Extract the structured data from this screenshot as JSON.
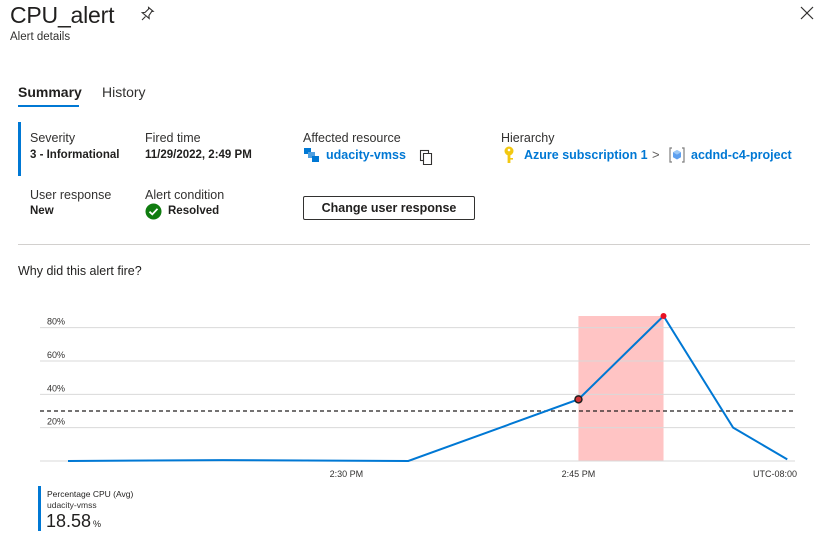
{
  "header": {
    "title": "CPU_alert",
    "subtitle": "Alert details"
  },
  "tabs": [
    {
      "label": "Summary",
      "active": true
    },
    {
      "label": "History",
      "active": false
    }
  ],
  "summary": {
    "severity_label": "Severity",
    "severity_value": "3 - Informational",
    "fired_label": "Fired time",
    "fired_value": "11/29/2022, 2:49 PM",
    "affected_label": "Affected resource",
    "affected_value": "udacity-vmss",
    "hierarchy_label": "Hierarchy",
    "hierarchy_subscription": "Azure subscription 1",
    "hierarchy_separator": ">",
    "hierarchy_group": "acdnd-c4-project",
    "user_response_label": "User response",
    "user_response_value": "New",
    "condition_label": "Alert condition",
    "condition_value": "Resolved",
    "change_button": "Change user response"
  },
  "why_title": "Why did this alert fire?",
  "colors": {
    "accent": "#0078d4",
    "line": "#0078d4",
    "highlight": "#ffc4c4",
    "resolved_green": "#107c10",
    "threshold": "#201f1e",
    "key_yellow": "#f2c811"
  },
  "chart_data": {
    "type": "line",
    "ytick_labels": [
      "80%",
      "60%",
      "40%",
      "20%"
    ],
    "ytick_values": [
      80,
      60,
      40,
      20
    ],
    "ylim": [
      0,
      87
    ],
    "xtick_labels": [
      "2:30 PM",
      "2:45 PM",
      "UTC-08:00"
    ],
    "xtick_minutes": [
      30,
      45,
      59
    ],
    "xlim_minutes": [
      12,
      59
    ],
    "x_minutes": [
      12,
      22,
      34,
      34,
      45,
      50.5,
      55,
      58.5
    ],
    "values": [
      0,
      0.5,
      0,
      0,
      37,
      87,
      20,
      1
    ],
    "threshold": 30,
    "highlight_range_minutes": [
      45,
      50.5
    ],
    "marked_points_index": [
      4,
      5
    ],
    "grid": true,
    "series": [
      {
        "name": "Percentage CPU (Avg)",
        "resource": "udacity-vmss"
      }
    ]
  },
  "legend": {
    "name": "Percentage CPU (Avg)",
    "resource": "udacity-vmss",
    "value": "18.58",
    "unit": "%"
  }
}
